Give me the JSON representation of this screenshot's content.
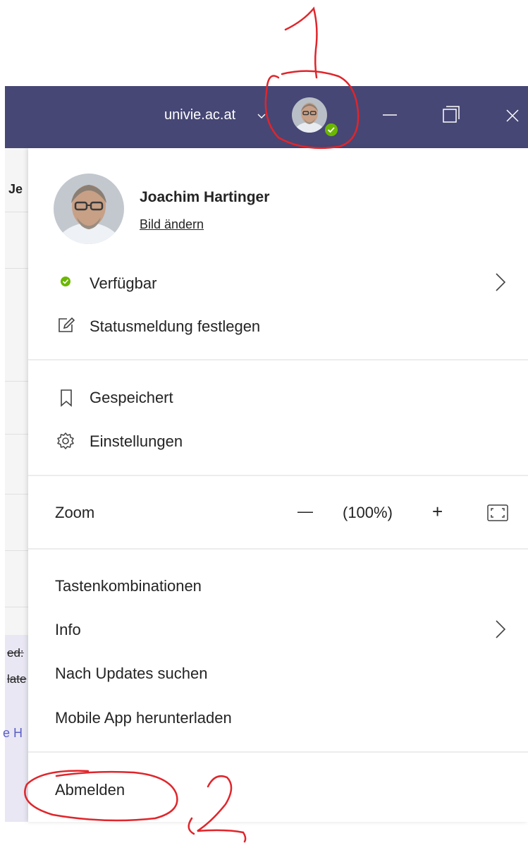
{
  "titlebar": {
    "tenant": "univie.ac.at",
    "bg_color": "#464775"
  },
  "profile": {
    "name": "Joachim Hartinger",
    "change_picture": "Bild ändern"
  },
  "status": {
    "label": "Verfügbar",
    "color": "#6bb700",
    "set_message": "Statusmeldung festlegen"
  },
  "menu": {
    "saved": "Gespeichert",
    "settings": "Einstellungen"
  },
  "zoom": {
    "label": "Zoom",
    "minus": "—",
    "value": "(100%)",
    "plus": "+"
  },
  "help": {
    "shortcuts": "Tastenkombinationen",
    "info": "Info",
    "updates": "Nach Updates suchen",
    "mobile": "Mobile App herunterladen"
  },
  "signout": "Abmelden",
  "background": {
    "partial_1": "Je",
    "partial_2": "ed:",
    "partial_3": "late",
    "partial_4": "e H"
  },
  "annotations": {
    "one": "1",
    "two": "2",
    "color": "#e0252b"
  }
}
